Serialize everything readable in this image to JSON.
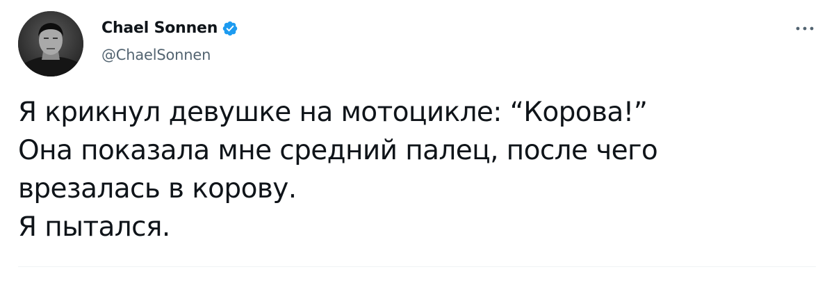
{
  "author": {
    "display_name": "Chael Sonnen",
    "handle": "@ChaelSonnen",
    "verified": true,
    "avatar_icon": "profile-photo",
    "verified_icon": "verified-badge-icon",
    "verified_color": "#1d9bf0"
  },
  "actions": {
    "more_icon": "more-horizontal-icon"
  },
  "tweet": {
    "lines": [
      "Я крикнул девушке на мотоцикле: “Корова!”",
      "Она показала мне средний палец, после чего",
      "врезалась в корову.",
      "Я пытался."
    ]
  },
  "colors": {
    "text": "#0f1419",
    "secondary_text": "#536471",
    "divider": "#eff3f4",
    "background": "#ffffff"
  }
}
